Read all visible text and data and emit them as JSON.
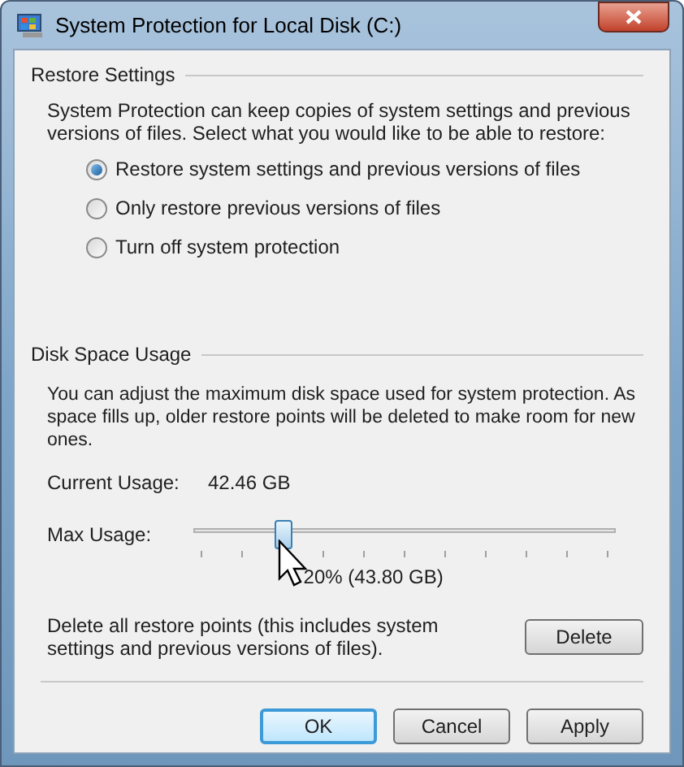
{
  "window": {
    "title": "System Protection for Local Disk (C:)"
  },
  "restore_settings": {
    "heading": "Restore Settings",
    "description": "System Protection can keep copies of system settings and previous versions of files. Select what you would like to be able to restore:",
    "options": [
      {
        "label": "Restore system settings and previous versions of files",
        "selected": true
      },
      {
        "label": "Only restore previous versions of files",
        "selected": false
      },
      {
        "label": "Turn off system protection",
        "selected": false
      }
    ]
  },
  "disk_space_usage": {
    "heading": "Disk Space Usage",
    "description": "You can adjust the maximum disk space used for system protection. As space fills up, older restore points will be deleted to make room for new ones.",
    "current_usage_label": "Current Usage:",
    "current_usage_value": "42.46 GB",
    "max_usage_label": "Max Usage:",
    "max_usage": {
      "level": 0.2,
      "reading": "20% (43.80 GB)"
    },
    "delete_text": "Delete all restore points (this includes system settings and previous versions of files).",
    "delete_button": "Delete"
  },
  "buttons": [
    {
      "label": "OK",
      "default": true
    },
    {
      "label": "Cancel",
      "default": false
    },
    {
      "label": "Apply",
      "default": false
    }
  ]
}
